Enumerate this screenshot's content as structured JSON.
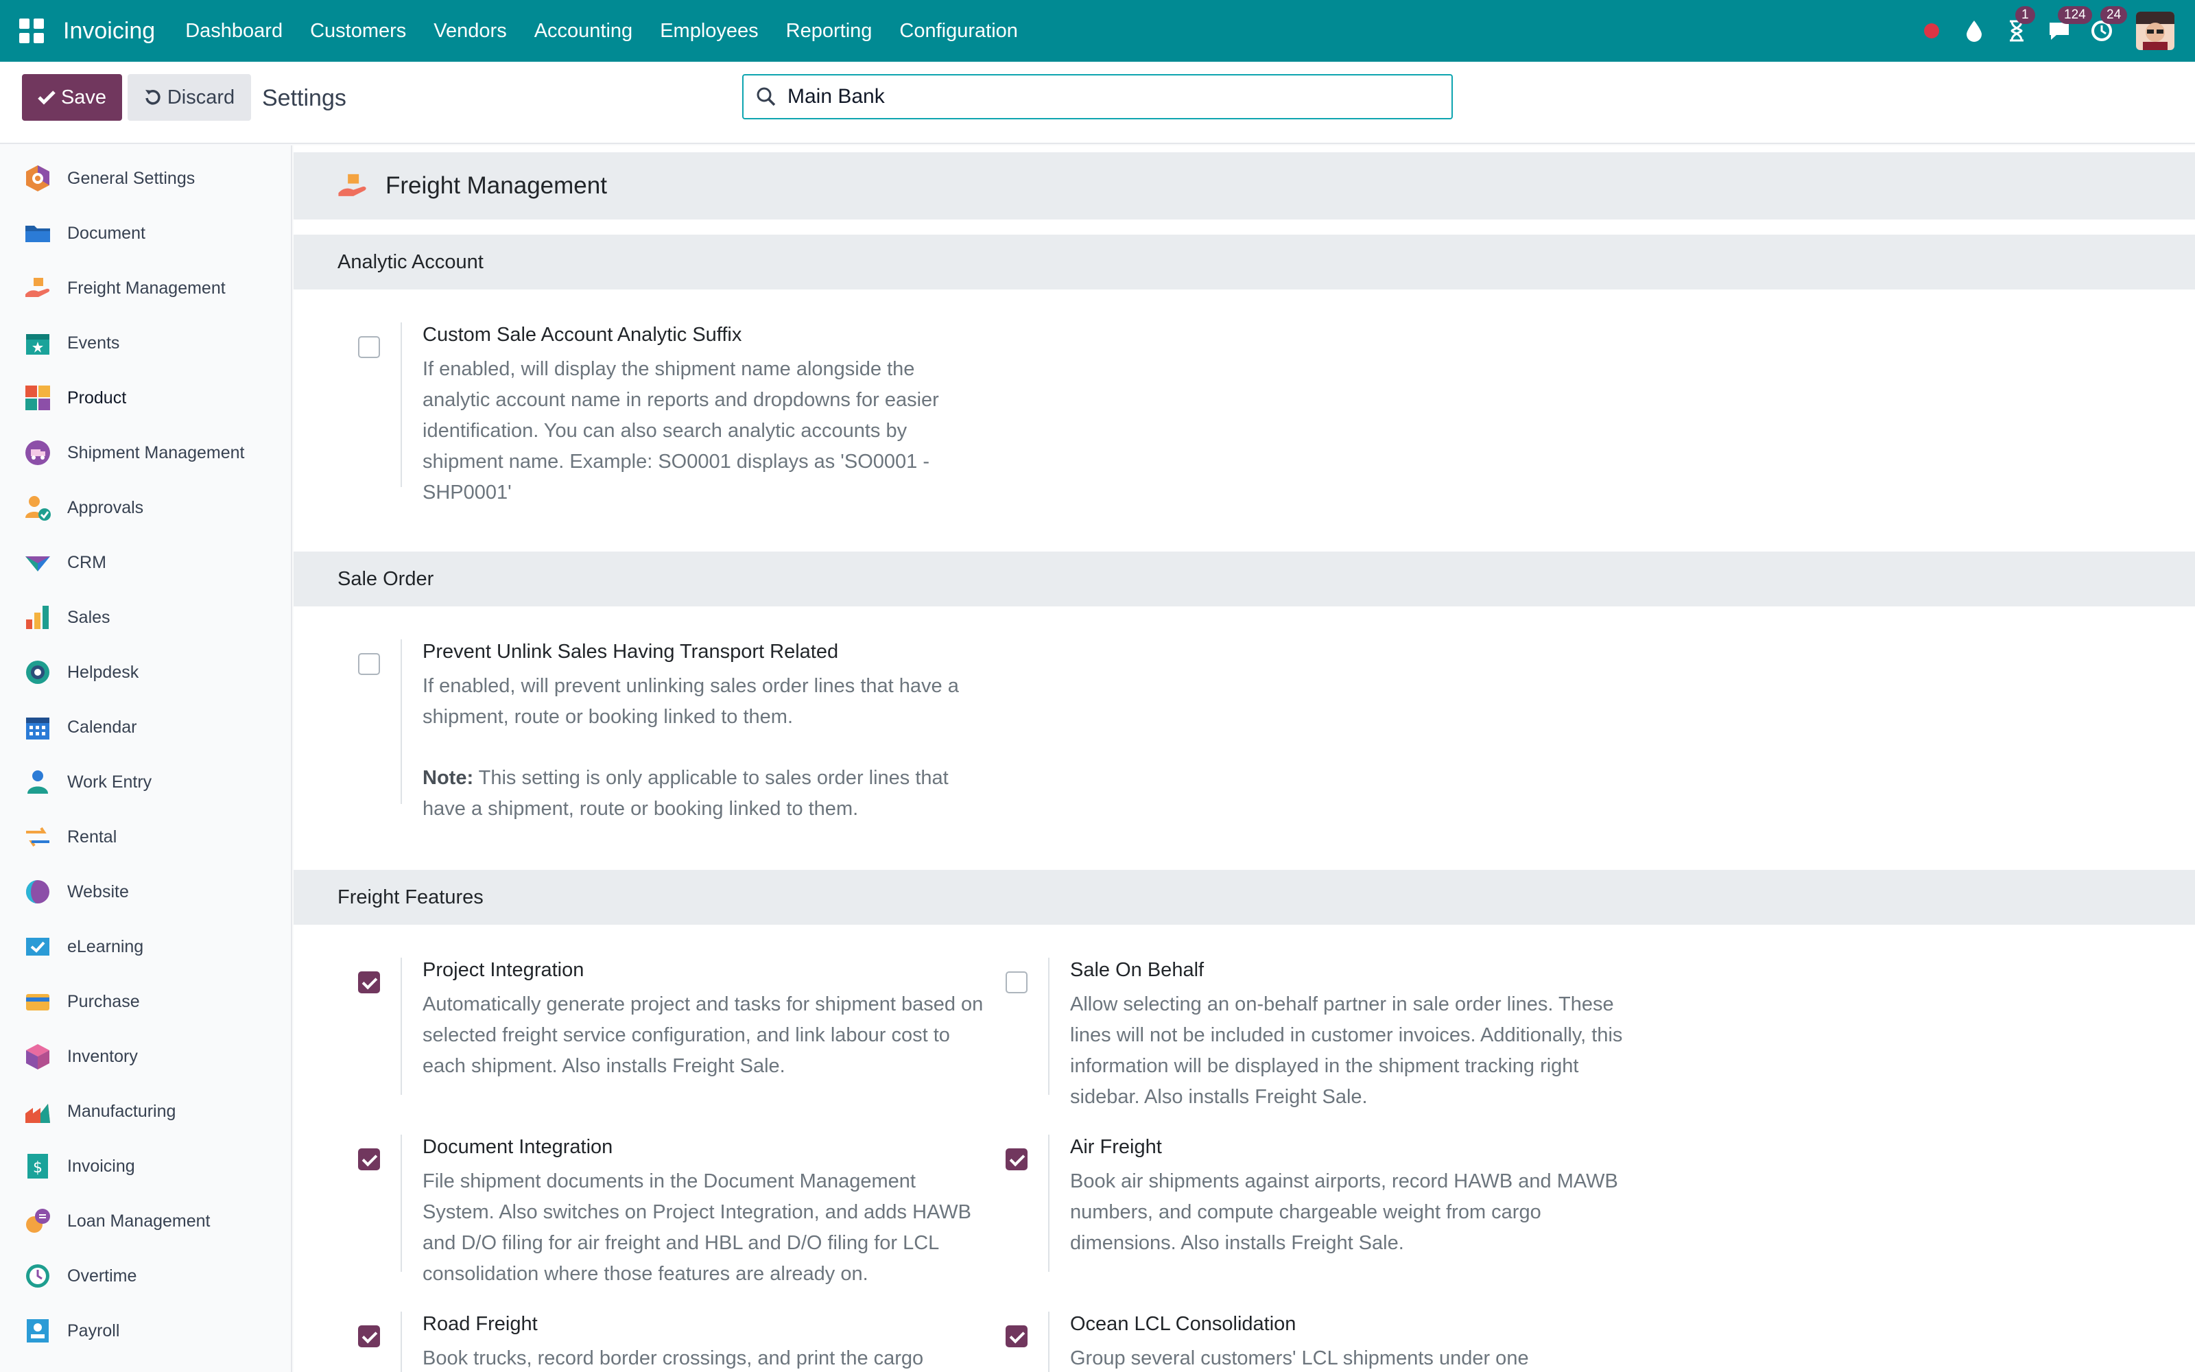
{
  "navbar": {
    "brand": "Invoicing",
    "menu": [
      "Dashboard",
      "Customers",
      "Vendors",
      "Accounting",
      "Employees",
      "Reporting",
      "Configuration"
    ],
    "badges": {
      "activity": "1",
      "messages": "124",
      "updates": "24"
    },
    "accent": "#018a93"
  },
  "control_panel": {
    "save_label": "Save",
    "discard_label": "Discard",
    "title": "Settings",
    "search_value": "Main Bank"
  },
  "sidebar": {
    "items": [
      {
        "label": "General Settings",
        "icon": "general-settings-icon"
      },
      {
        "label": "Document",
        "icon": "document-folder-icon"
      },
      {
        "label": "Freight Management",
        "icon": "freight-management-icon"
      },
      {
        "label": "Events",
        "icon": "events-icon"
      },
      {
        "label": "Product",
        "icon": "product-icon"
      },
      {
        "label": "Shipment Management",
        "icon": "shipment-management-icon"
      },
      {
        "label": "Approvals",
        "icon": "approvals-icon"
      },
      {
        "label": "CRM",
        "icon": "crm-icon"
      },
      {
        "label": "Sales",
        "icon": "sales-icon"
      },
      {
        "label": "Helpdesk",
        "icon": "helpdesk-icon"
      },
      {
        "label": "Calendar",
        "icon": "calendar-icon"
      },
      {
        "label": "Work Entry",
        "icon": "work-entry-icon"
      },
      {
        "label": "Rental",
        "icon": "rental-icon"
      },
      {
        "label": "Website",
        "icon": "website-icon"
      },
      {
        "label": "eLearning",
        "icon": "elearning-icon"
      },
      {
        "label": "Purchase",
        "icon": "purchase-icon"
      },
      {
        "label": "Inventory",
        "icon": "inventory-icon"
      },
      {
        "label": "Manufacturing",
        "icon": "manufacturing-icon"
      },
      {
        "label": "Invoicing",
        "icon": "invoicing-icon"
      },
      {
        "label": "Loan Management",
        "icon": "loan-management-icon"
      },
      {
        "label": "Overtime",
        "icon": "overtime-icon"
      },
      {
        "label": "Payroll",
        "icon": "payroll-icon"
      }
    ]
  },
  "main": {
    "app_title": "Freight Management",
    "sections": [
      {
        "title": "Analytic Account"
      },
      {
        "title": "Sale Order"
      },
      {
        "title": "Freight Features"
      }
    ],
    "settings": [
      {
        "title": "Custom Sale Account Analytic Suffix",
        "description": "If enabled, will display the shipment name alongside the analytic account name in reports and dropdowns for easier identification. You can also search analytic accounts by shipment name. Example: SO0001 displays as 'SO0001 - SHP0001'",
        "checked": false
      },
      {
        "title": "Prevent Unlink Sales Having Transport Related",
        "description": "If enabled, will prevent unlinking sales order lines that have a shipment, route or booking linked to them.",
        "note_label": "Note:",
        "note_text": " This setting is only applicable to sales order lines that have a shipment, route or booking linked to them.",
        "checked": false
      },
      {
        "title": "Project Integration",
        "description": "Automatically generate project and tasks for shipment based on selected freight service configuration, and link labour cost to each shipment. Also installs Freight Sale.",
        "checked": true
      },
      {
        "title": "Sale On Behalf",
        "description": "Allow selecting an on-behalf partner in sale order lines. These lines will not be included in customer invoices. Additionally, this information will be displayed in the shipment tracking right sidebar. Also installs Freight Sale.",
        "checked": false
      },
      {
        "title": "Document Integration",
        "description": "File shipment documents in the Document Management System. Also switches on Project Integration, and adds HAWB and D/O filing for air freight and HBL and D/O filing for LCL consolidation where those features are already on.",
        "checked": true
      },
      {
        "title": "Air Freight",
        "description": "Book air shipments against airports, record HAWB and MAWB numbers, and compute chargeable weight from cargo dimensions. Also installs Freight Sale.",
        "checked": true
      },
      {
        "title": "Road Freight",
        "description": "Book trucks, record border crossings, and print the cargo",
        "checked": true
      },
      {
        "title": "Ocean LCL Consolidation",
        "description": "Group several customers' LCL shipments under one",
        "checked": true
      }
    ]
  }
}
